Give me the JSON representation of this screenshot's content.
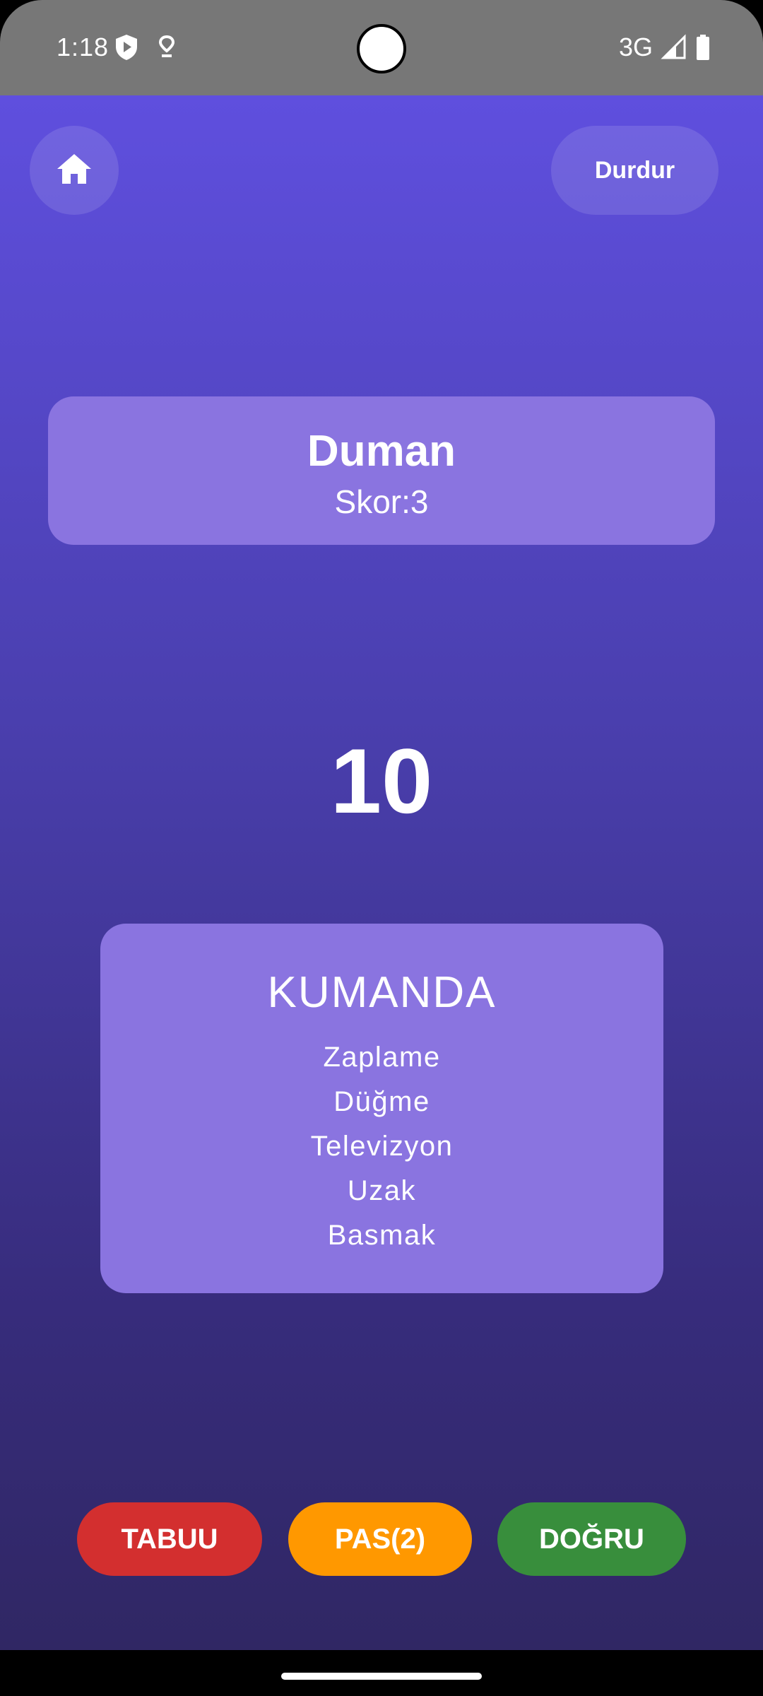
{
  "status_bar": {
    "time": "1:18",
    "network": "3G",
    "icons": [
      "shield-play-icon",
      "location-pin-icon",
      "signal-icon",
      "battery-icon"
    ]
  },
  "header": {
    "home_icon": "home-icon",
    "pause_label": "Durdur"
  },
  "team": {
    "name": "Duman",
    "score": "Skor:3"
  },
  "timer": {
    "value": "10"
  },
  "card": {
    "word": "KUMANDA",
    "forbidden": [
      "Zaplame",
      "Düğme",
      "Televizyon",
      "Uzak",
      "Basmak"
    ]
  },
  "actions": {
    "taboo_label": "TABUU",
    "pass_label": "PAS(2)",
    "correct_label": "DOĞRU"
  },
  "colors": {
    "taboo": "#d32f2f",
    "pass": "#ff9800",
    "correct": "#388e3c",
    "card": "#8a74e0"
  }
}
